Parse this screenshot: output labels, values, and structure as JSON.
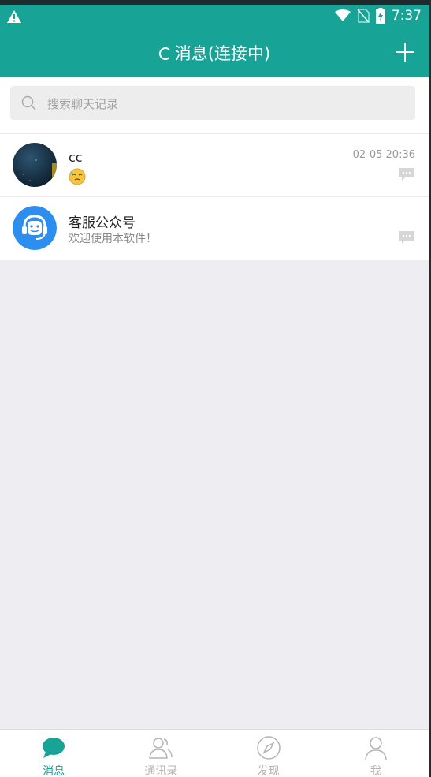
{
  "status_bar": {
    "time": "7:37"
  },
  "header": {
    "title": "消息(连接中)"
  },
  "search": {
    "placeholder": "搜索聊天记录"
  },
  "conversations": [
    {
      "name": "cc",
      "time": "02-05 20:36",
      "preview_icon": "sleepy-emoji-icon"
    },
    {
      "name": "客服公众号",
      "preview": "欢迎使用本软件！",
      "avatar_icon": "customer-service-icon"
    }
  ],
  "tabs": [
    {
      "label": "消息",
      "icon": "chat-icon",
      "active": true
    },
    {
      "label": "通讯录",
      "icon": "contacts-icon"
    },
    {
      "label": "发现",
      "icon": "compass-icon"
    },
    {
      "label": "我",
      "icon": "person-icon"
    }
  ],
  "colors": {
    "primary": "#17a396",
    "background": "#ededf2",
    "inactive": "#b4b4b4"
  }
}
